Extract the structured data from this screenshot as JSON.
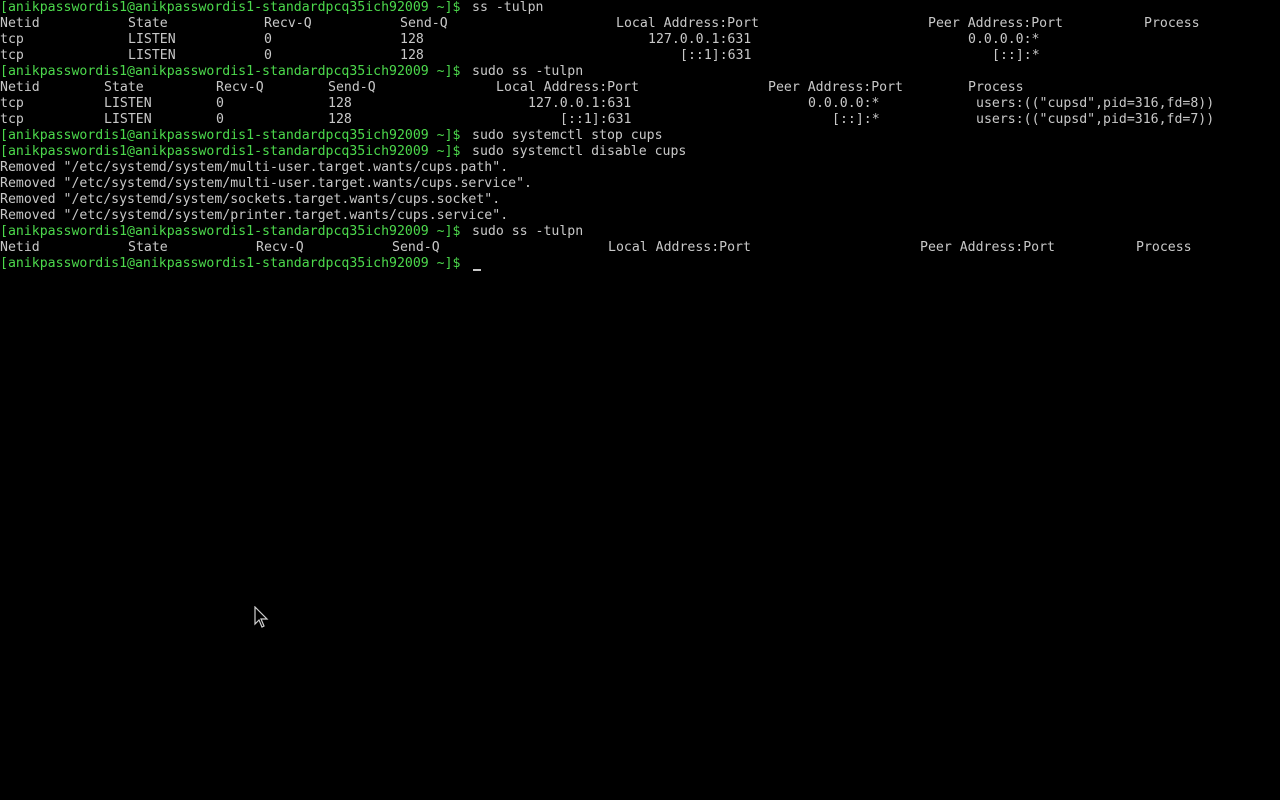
{
  "colors": {
    "background": "#000000",
    "prompt": "#4cd94c",
    "text": "#c8c8c8"
  },
  "prompt": "[anikpasswordis1@anikpasswordis1-standardpcq35ich92009 ~]$",
  "block1": {
    "command": "ss -tulpn",
    "header": {
      "netid": "Netid",
      "state": "State",
      "recvq": "Recv-Q",
      "sendq": "Send-Q",
      "local": "Local Address:Port",
      "peer": "Peer Address:Port",
      "process": "Process"
    },
    "rows": [
      {
        "netid": "tcp",
        "state": "LISTEN",
        "recvq": "0",
        "sendq": "128",
        "local": "127.0.0.1:631",
        "peer": "0.0.0.0:*"
      },
      {
        "netid": "tcp",
        "state": "LISTEN",
        "recvq": "0",
        "sendq": "128",
        "local": "[::1]:631",
        "peer": "[::]:*"
      }
    ]
  },
  "block2": {
    "command": "sudo ss -tulpn",
    "header": {
      "netid": "Netid",
      "state": "State",
      "recvq": "Recv-Q",
      "sendq": "Send-Q",
      "local": "Local Address:Port",
      "peer": "Peer Address:Port",
      "process": "Process"
    },
    "rows": [
      {
        "netid": "tcp",
        "state": "LISTEN",
        "recvq": "0",
        "sendq": "128",
        "local": "127.0.0.1:631",
        "peer": "0.0.0.0:*",
        "process": "users:((\"cupsd\",pid=316,fd=8))"
      },
      {
        "netid": "tcp",
        "state": "LISTEN",
        "recvq": "0",
        "sendq": "128",
        "local": "[::1]:631",
        "peer": "[::]:*",
        "process": "users:((\"cupsd\",pid=316,fd=7))"
      }
    ]
  },
  "block3": {
    "command": "sudo systemctl stop cups"
  },
  "block4": {
    "command": "sudo systemctl disable cups",
    "output": [
      "Removed \"/etc/systemd/system/multi-user.target.wants/cups.path\".",
      "Removed \"/etc/systemd/system/multi-user.target.wants/cups.service\".",
      "Removed \"/etc/systemd/system/sockets.target.wants/cups.socket\".",
      "Removed \"/etc/systemd/system/printer.target.wants/cups.service\"."
    ]
  },
  "block5": {
    "command": "sudo ss -tulpn",
    "header": {
      "netid": "Netid",
      "state": "State",
      "recvq": "Recv-Q",
      "sendq": "Send-Q",
      "local": "Local Address:Port",
      "peer": "Peer Address:Port",
      "process": "Process"
    }
  },
  "icons": {
    "mouse": "mouse-pointer-icon"
  }
}
